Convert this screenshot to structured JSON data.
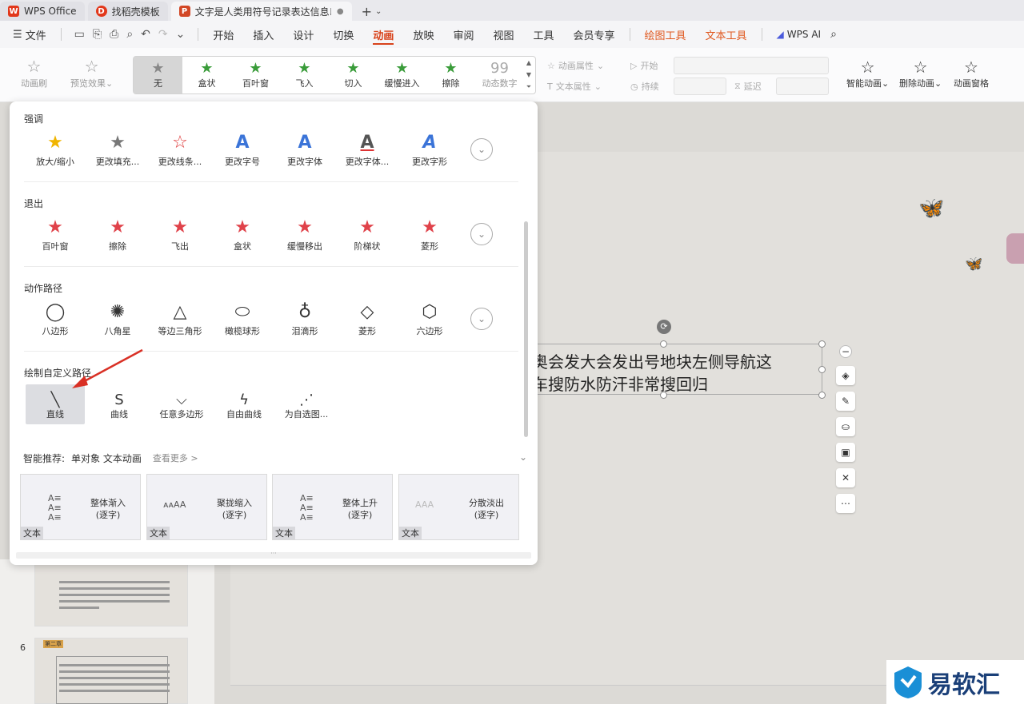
{
  "tabs": [
    {
      "label": "WPS Office",
      "badge": "W",
      "color": "#e2381b"
    },
    {
      "label": "找稻壳模板",
      "badge": "D",
      "color": "#e2381b"
    },
    {
      "label": "文字是人类用符号记录表达信息以",
      "badge": "P",
      "color": "#d24726",
      "status": "●"
    }
  ],
  "tab_add": "+",
  "menu": {
    "file": "文件",
    "items": [
      "开始",
      "插入",
      "设计",
      "切换",
      "动画",
      "放映",
      "审阅",
      "视图",
      "工具",
      "会员专享"
    ],
    "active": "动画",
    "context": [
      "绘图工具",
      "文本工具"
    ],
    "ai": "WPS AI"
  },
  "ribbon": {
    "left": [
      {
        "label": "动画刷"
      },
      {
        "label": "预览效果"
      }
    ],
    "gallery": [
      {
        "label": "无",
        "icon": "★"
      },
      {
        "label": "盒状",
        "icon": "★"
      },
      {
        "label": "百叶窗",
        "icon": "★"
      },
      {
        "label": "飞入",
        "icon": "★"
      },
      {
        "label": "切入",
        "icon": "★"
      },
      {
        "label": "缓慢进入",
        "icon": "★"
      },
      {
        "label": "擦除",
        "icon": "★"
      },
      {
        "label": "动态数字",
        "icon": "99"
      }
    ],
    "props": {
      "anim": "动画属性",
      "text": "文本属性",
      "start": "开始",
      "duration": "持续",
      "delay": "延迟"
    },
    "right": [
      {
        "label": "智能动画"
      },
      {
        "label": "删除动画"
      },
      {
        "label": "动画窗格"
      }
    ]
  },
  "panel": {
    "sections": [
      {
        "title": "强调",
        "items": [
          {
            "label": "放大/缩小",
            "icon": "★",
            "color": "#f0b400"
          },
          {
            "label": "更改填充...",
            "icon": "★",
            "color": "#777"
          },
          {
            "label": "更改线条...",
            "icon": "☆",
            "color": "#d33"
          },
          {
            "label": "更改字号",
            "icon": "A",
            "color": "#3b74d8"
          },
          {
            "label": "更改字体",
            "icon": "A",
            "color": "#3b74d8"
          },
          {
            "label": "更改字体...",
            "icon": "A",
            "color": "#555"
          },
          {
            "label": "更改字形",
            "icon": "A",
            "color": "#3b74d8"
          }
        ]
      },
      {
        "title": "退出",
        "items": [
          {
            "label": "百叶窗",
            "icon": "★",
            "color": "#e0424a"
          },
          {
            "label": "擦除",
            "icon": "★",
            "color": "#e0424a"
          },
          {
            "label": "飞出",
            "icon": "★",
            "color": "#e0424a"
          },
          {
            "label": "盒状",
            "icon": "★",
            "color": "#e0424a"
          },
          {
            "label": "缓慢移出",
            "icon": "★",
            "color": "#e0424a"
          },
          {
            "label": "阶梯状",
            "icon": "★",
            "color": "#e0424a"
          },
          {
            "label": "菱形",
            "icon": "★",
            "color": "#e0424a"
          }
        ]
      },
      {
        "title": "动作路径",
        "items": [
          {
            "label": "八边形",
            "icon": "◯",
            "color": "#555"
          },
          {
            "label": "八角星",
            "icon": "✺",
            "color": "#555"
          },
          {
            "label": "等边三角形",
            "icon": "△",
            "color": "#555"
          },
          {
            "label": "橄榄球形",
            "icon": "⬭",
            "color": "#555"
          },
          {
            "label": "泪滴形",
            "icon": "♁",
            "color": "#555"
          },
          {
            "label": "菱形",
            "icon": "◇",
            "color": "#555"
          },
          {
            "label": "六边形",
            "icon": "⬡",
            "color": "#555"
          }
        ]
      },
      {
        "title": "绘制自定义路径",
        "items": [
          {
            "label": "直线",
            "icon": "╲",
            "color": "#555"
          },
          {
            "label": "曲线",
            "icon": "S",
            "color": "#555"
          },
          {
            "label": "任意多边形",
            "icon": "⌵",
            "color": "#555"
          },
          {
            "label": "自由曲线",
            "icon": "ϟ",
            "color": "#555"
          },
          {
            "label": "为自选图...",
            "icon": "⋰",
            "color": "#555"
          }
        ]
      }
    ],
    "smart": {
      "label": "智能推荐:",
      "sub": "单对象 文本动画",
      "more": "查看更多 >"
    },
    "cards": [
      {
        "name1": "整体渐入",
        "name2": "(逐字)",
        "tag": "文本",
        "icon": "A≡ A≡ A≡"
      },
      {
        "name1": "聚拢缩入",
        "name2": "(逐字)",
        "tag": "文本",
        "icon": "AAA"
      },
      {
        "name1": "整体上升",
        "name2": "(逐字)",
        "tag": "文本",
        "icon": "A≡ A≡ A≡"
      },
      {
        "name1": "分散淡出",
        "name2": "(逐字)",
        "tag": "文本",
        "icon": "AAA"
      }
    ]
  },
  "slide": {
    "line1": "奥会发大会发出号地块左侧导航这",
    "line2": "车搜防水防汗非常搜回归"
  },
  "thumbs": {
    "num6": "6",
    "chapter": "第二章"
  },
  "brand": {
    "name": "易软汇"
  }
}
